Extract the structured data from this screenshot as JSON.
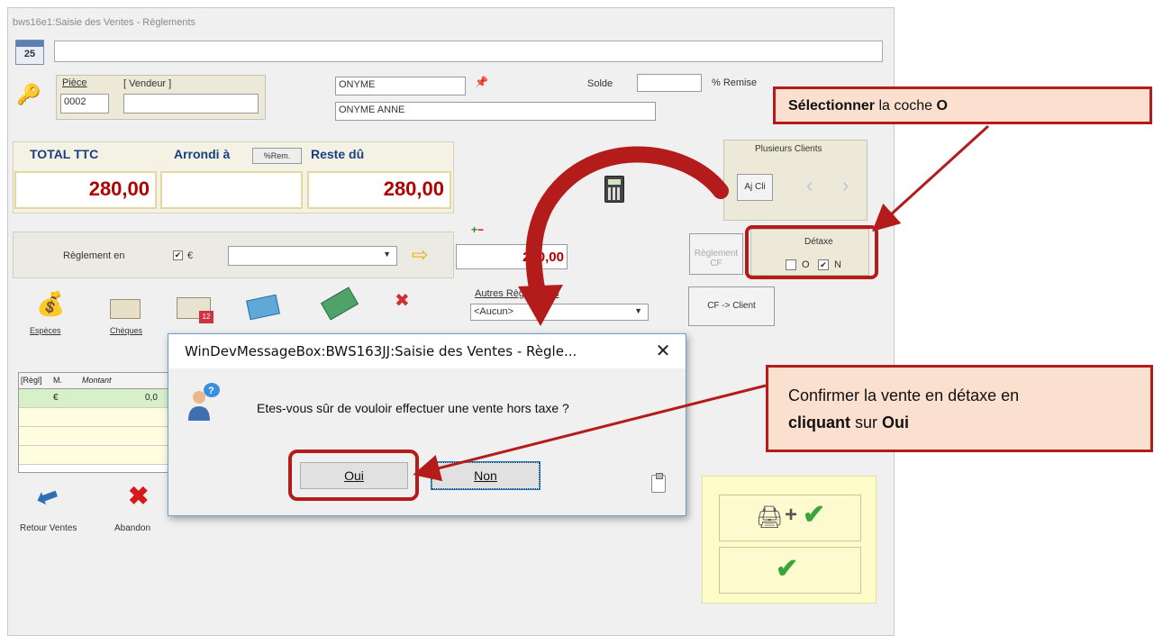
{
  "window": {
    "title": "bws16e1:Saisie des Ventes - Règlements",
    "calendar_day": "25"
  },
  "header": {
    "piece_label": "Pièce",
    "piece_value": "0002",
    "vendeur_label": "[ Vendeur ]",
    "vendeur_value": "",
    "client_code": "ONYME",
    "client_name": "ONYME ANNE",
    "solde_label": "Solde",
    "solde_value": "",
    "remise_label": "% Remise"
  },
  "totals": {
    "total_label": "TOTAL TTC",
    "total_value": "280,00",
    "arrondi_label": "Arrondi à",
    "arrondi_button": "%Rem.",
    "arrondi_value": "",
    "reste_label": "Reste dû",
    "reste_value": "280,00"
  },
  "plusieurs_clients": {
    "title": "Plusieurs Clients",
    "aj_button": "Aj Cli",
    "prev_icon": "chevron-left-icon",
    "next_icon": "chevron-right-icon"
  },
  "reglement": {
    "label": "Règlement en",
    "currency_checked": true,
    "currency": "€",
    "mode_value": "",
    "amount_value": "280,00",
    "reglement_cf_button": "Règlement CF",
    "cf_client_button": "CF -> Client"
  },
  "detaxe": {
    "label": "Détaxe",
    "option_o": "O",
    "option_o_checked": false,
    "option_n": "N",
    "option_n_checked": true
  },
  "payment_modes": [
    {
      "label": "Espèces",
      "icon": "coins-icon"
    },
    {
      "label": "Chèques",
      "icon": "cheque-icon"
    },
    {
      "label": "",
      "icon": "calendar-cheque-icon"
    },
    {
      "label": "",
      "icon": "credit-card-icon"
    },
    {
      "label": "",
      "icon": "card-chip-icon"
    },
    {
      "label": "",
      "icon": "gift-icon"
    }
  ],
  "autres_reglements": {
    "label": "Autres Règlements",
    "value": "<Aucun>"
  },
  "grid": {
    "headers": [
      "[Règl]",
      "M.",
      "Montant"
    ],
    "rows": [
      {
        "reg": "",
        "m": "€",
        "montant": "0,0"
      }
    ]
  },
  "bottom_actions": {
    "retour": "Retour Ventes",
    "abandon": "Abandon"
  },
  "dialog": {
    "title": "WinDevMessageBox:BWS163JJ:Saisie des Ventes - Règle...",
    "message": "Etes-vous sûr de vouloir effectuer une vente hors taxe ?",
    "oui_label": "Oui",
    "non_label": "Non",
    "close_glyph": "✕"
  },
  "callouts": {
    "c1_bold1": "Sélectionner",
    "c1_text": " la coche ",
    "c1_bold2": "O",
    "c2_line1": "Confirmer la vente en détaxe en",
    "c2_bold1": "cliquant",
    "c2_text": " sur ",
    "c2_bold2": "Oui"
  },
  "validate": {
    "print_plus": "+"
  },
  "colors": {
    "callout_border": "#b41c1c",
    "callout_fill": "#fbe0cf",
    "amount_red": "#b00000",
    "header_blue": "#1a3e80"
  }
}
